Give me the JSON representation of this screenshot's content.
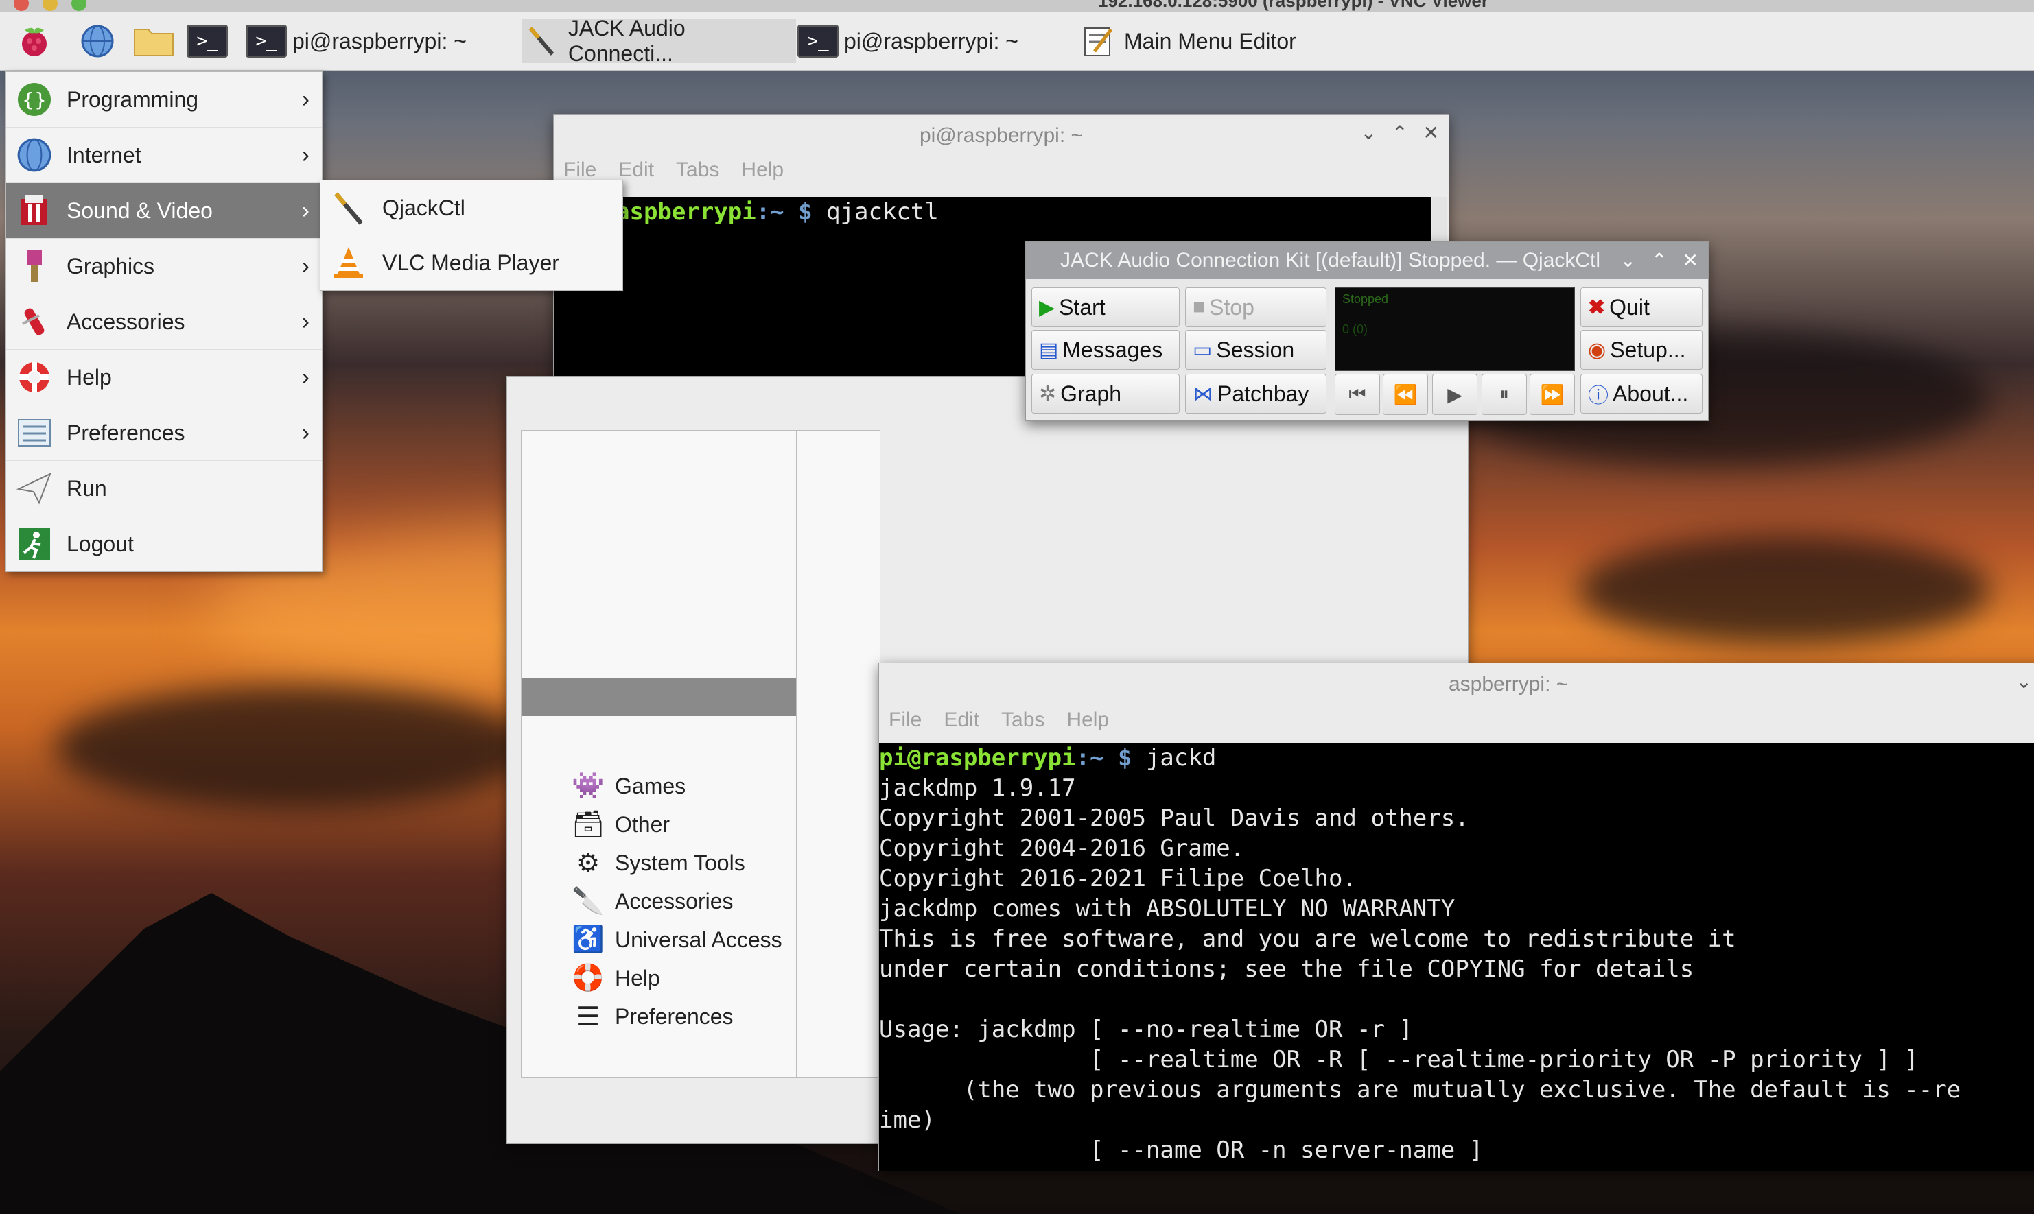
{
  "vnc_title": "192.168.0.128:5900 (raspberrypi) - VNC Viewer",
  "colors": {
    "prompt_user": "#8ae234",
    "prompt_dir": "#729fcf",
    "menu_active": "#7a7a7a",
    "terminal_bg": "#000000"
  },
  "taskbar": {
    "launchers": [
      "raspberry-icon",
      "globe-icon",
      "folder-icon",
      "terminal-icon"
    ],
    "tasks": [
      {
        "label": "pi@raspberrypi: ~",
        "icon": "terminal-icon"
      },
      {
        "label": "JACK Audio Connecti...",
        "icon": "qjackctl-icon"
      },
      {
        "label": "pi@raspberrypi: ~",
        "icon": "terminal-icon"
      },
      {
        "label": "Main Menu Editor",
        "icon": "menu-editor-icon"
      }
    ]
  },
  "app_menu": {
    "items": [
      {
        "label": "Programming",
        "icon": "programming-icon",
        "has_submenu": true
      },
      {
        "label": "Internet",
        "icon": "globe-icon",
        "has_submenu": true
      },
      {
        "label": "Sound & Video",
        "icon": "sound-video-icon",
        "has_submenu": true,
        "active": true
      },
      {
        "label": "Graphics",
        "icon": "graphics-icon",
        "has_submenu": true
      },
      {
        "label": "Accessories",
        "icon": "accessories-icon",
        "has_submenu": true
      },
      {
        "label": "Help",
        "icon": "help-icon",
        "has_submenu": true
      },
      {
        "label": "Preferences",
        "icon": "preferences-icon",
        "has_submenu": true
      },
      {
        "label": "Run",
        "icon": "run-icon",
        "has_submenu": false
      },
      {
        "label": "Logout",
        "icon": "logout-icon",
        "has_submenu": false
      }
    ],
    "submenu": [
      {
        "label": "QjackCtl",
        "icon": "qjackctl-icon"
      },
      {
        "label": "VLC Media Player",
        "icon": "vlc-icon"
      }
    ]
  },
  "terminal1": {
    "title": "pi@raspberrypi: ~",
    "menu": [
      "File",
      "Edit",
      "Tabs",
      "Help"
    ],
    "line_user": "aspberrypi",
    "line_dir": ":~ $ ",
    "command": "qjackctl"
  },
  "qjackctl": {
    "title": "JACK Audio Connection Kit [(default)] Stopped. — QjackCtl",
    "buttons": {
      "start": "Start",
      "stop": "Stop",
      "quit": "Quit",
      "messages": "Messages",
      "session": "Session",
      "setup": "Setup...",
      "graph": "Graph",
      "patchbay": "Patchbay",
      "about": "About..."
    },
    "display_status": "Stopped",
    "display_sub": "0 (0)"
  },
  "menu_editor": {
    "items": [
      "Games",
      "Other",
      "System Tools",
      "Accessories",
      "Universal Access",
      "Help",
      "Preferences"
    ]
  },
  "terminal2": {
    "title": "aspberrypi: ~",
    "menu": [
      "File",
      "Edit",
      "Tabs",
      "Help"
    ],
    "prompt_user": "pi@raspberrypi",
    "prompt_dir": ":~ $ ",
    "command": "jackd",
    "lines": [
      "jackdmp 1.9.17",
      "Copyright 2001-2005 Paul Davis and others.",
      "Copyright 2004-2016 Grame.",
      "Copyright 2016-2021 Filipe Coelho.",
      "jackdmp comes with ABSOLUTELY NO WARRANTY",
      "This is free software, and you are welcome to redistribute it",
      "under certain conditions; see the file COPYING for details",
      "",
      "Usage: jackdmp [ --no-realtime OR -r ]",
      "               [ --realtime OR -R [ --realtime-priority OR -P priority ] ]",
      "      (the two previous arguments are mutually exclusive. The default is --re",
      "ime)",
      "               [ --name OR -n server-name ]"
    ]
  }
}
